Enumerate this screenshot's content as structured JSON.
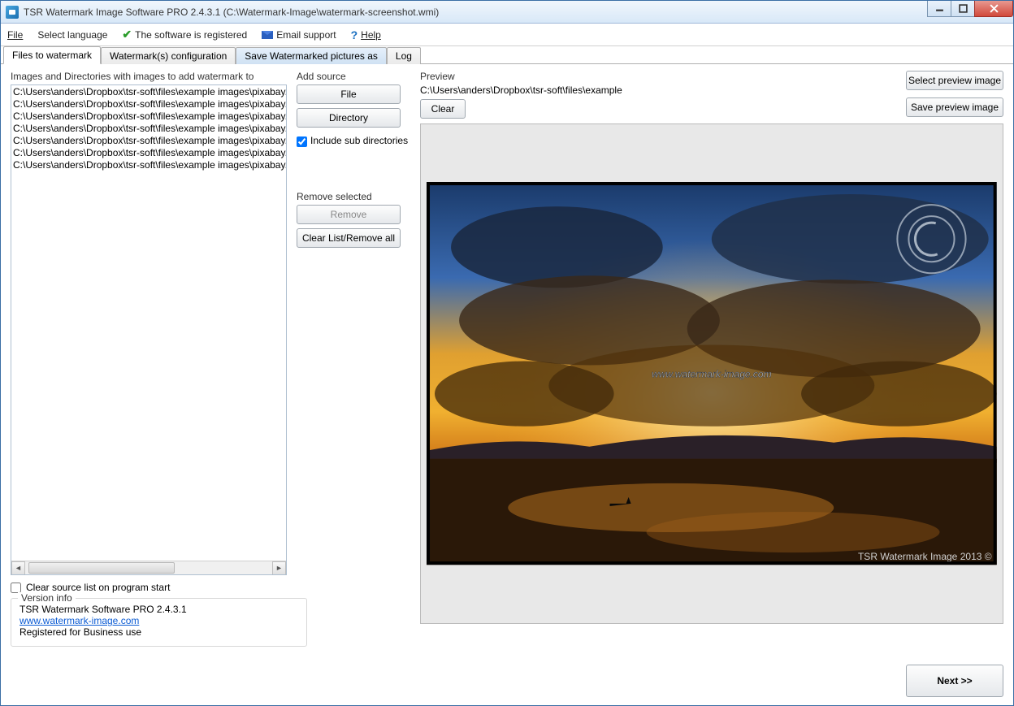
{
  "window": {
    "title": "TSR Watermark Image Software PRO 2.4.3.1 (C:\\Watermark-Image\\watermark-screenshot.wmi)"
  },
  "menu": {
    "file": "File",
    "language": "Select language",
    "registered": "The software is registered",
    "email": "Email support",
    "help": "Help"
  },
  "tabs": {
    "files": "Files to watermark",
    "config": "Watermark(s) configuration",
    "save": "Save Watermarked pictures as",
    "log": "Log"
  },
  "left": {
    "label": "Images and Directories with images to add watermark to",
    "items": [
      "C:\\Users\\anders\\Dropbox\\tsr-soft\\files\\example images\\pixabay.co",
      "C:\\Users\\anders\\Dropbox\\tsr-soft\\files\\example images\\pixabay.co",
      "C:\\Users\\anders\\Dropbox\\tsr-soft\\files\\example images\\pixabay.co",
      "C:\\Users\\anders\\Dropbox\\tsr-soft\\files\\example images\\pixabay.co",
      "C:\\Users\\anders\\Dropbox\\tsr-soft\\files\\example images\\pixabay.co",
      "C:\\Users\\anders\\Dropbox\\tsr-soft\\files\\example images\\pixabay.co",
      "C:\\Users\\anders\\Dropbox\\tsr-soft\\files\\example images\\pixabay.co"
    ],
    "clear_on_start": "Clear source list on program start"
  },
  "mid": {
    "add_source": "Add source",
    "file_btn": "File",
    "dir_btn": "Directory",
    "include_sub": "Include sub directories",
    "remove_sel": "Remove selected",
    "remove_btn": "Remove",
    "clearall_btn": "Clear List/Remove all"
  },
  "preview": {
    "label": "Preview",
    "path": "C:\\Users\\anders\\Dropbox\\tsr-soft\\files\\example",
    "clear": "Clear",
    "select": "Select preview image",
    "save": "Save preview image",
    "watermark_text": "www.watermark-image.com",
    "corner_text": "TSR Watermark Image 2013 ©"
  },
  "version": {
    "legend": "Version info",
    "line1": "TSR Watermark Software PRO 2.4.3.1",
    "link": "www.watermark-image.com",
    "line3": "Registered for Business use"
  },
  "next": "Next >>"
}
